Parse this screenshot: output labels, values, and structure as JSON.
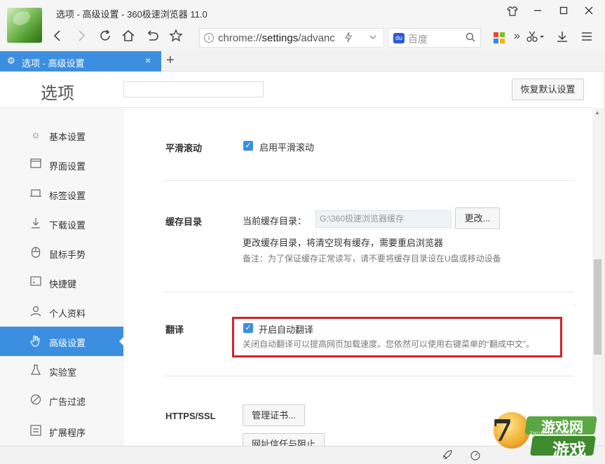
{
  "window": {
    "title": "选项 - 高级设置 - 360极速浏览器 11.0"
  },
  "toolbar": {
    "address_prefix": "chrome://",
    "address_bold": "settings",
    "address_suffix": "/advanc",
    "search_placeholder": "百度"
  },
  "tabs": [
    {
      "label": "选项 - 高级设置",
      "active": true
    }
  ],
  "header": {
    "title": "选项",
    "search_value": "",
    "restore_button": "恢复默认设置"
  },
  "sidebar": {
    "items": [
      {
        "label": "基本设置",
        "icon": "sun-icon",
        "active": false
      },
      {
        "label": "界面设置",
        "icon": "window-icon",
        "active": false
      },
      {
        "label": "标签设置",
        "icon": "tab-icon",
        "active": false
      },
      {
        "label": "下载设置",
        "icon": "download-icon",
        "active": false
      },
      {
        "label": "鼠标手势",
        "icon": "mouse-icon",
        "active": false
      },
      {
        "label": "快捷键",
        "icon": "keyboard-icon",
        "active": false
      },
      {
        "label": "个人资料",
        "icon": "person-icon",
        "active": false
      },
      {
        "label": "高级设置",
        "icon": "hand-icon",
        "active": true
      },
      {
        "label": "实验室",
        "icon": "flask-icon",
        "active": false
      },
      {
        "label": "广告过滤",
        "icon": "block-icon",
        "active": false
      },
      {
        "label": "扩展程序",
        "icon": "extension-icon",
        "active": false
      }
    ]
  },
  "sections": {
    "smooth_scroll": {
      "label": "平滑滚动",
      "checkbox_label": "启用平滑滚动",
      "checked": true
    },
    "cache": {
      "label": "缓存目录",
      "current_label": "当前缓存目录：",
      "path_value": "G:\\360极速浏览器缓存",
      "change_button": "更改...",
      "note1": "更改缓存目录，将清空现有缓存，需要重启浏览器",
      "note2": "备注：为了保证缓存正常读写，请不要将缓存目录设在U盘或移动设备"
    },
    "translate": {
      "label": "翻译",
      "checkbox_label": "开启自动翻译",
      "checked": true,
      "description": "关闭自动翻译可以提高网页加载速度。您依然可以使用右键菜单的“翻成中文”。"
    },
    "https": {
      "label": "HTTPS/SSL",
      "cert_button": "管理证书...",
      "trust_button": "网址信任与阻止"
    }
  },
  "watermark": {
    "text1": "游戏网",
    "text2": "游戏",
    "small": "ZHUOYOUXIWANG"
  },
  "colors": {
    "accent": "#3c8fe0",
    "highlight_border": "#d1232a"
  }
}
